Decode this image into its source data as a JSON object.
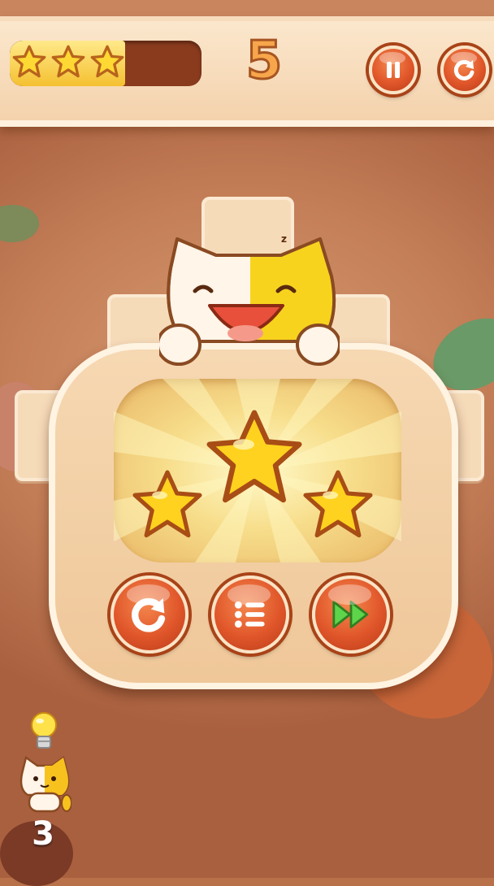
{
  "hud": {
    "stars_earned": 3,
    "progress": 0.6,
    "level": "5",
    "pause_icon": "pause-icon",
    "restart_icon": "restart-icon"
  },
  "result": {
    "stars_earned": 3,
    "buttons": [
      {
        "name": "replay-button",
        "icon": "restart-icon"
      },
      {
        "name": "level-menu-button",
        "icon": "list-icon"
      },
      {
        "name": "next-level-button",
        "icon": "fast-forward-icon"
      }
    ]
  },
  "hints": {
    "icon": "lightbulb-icon",
    "count": "3"
  },
  "colors": {
    "accent_orange": "#e0562a",
    "star_yellow": "#f7c21e",
    "progress_fill": "#f4c030",
    "panel_cream": "#f6d8b2"
  }
}
